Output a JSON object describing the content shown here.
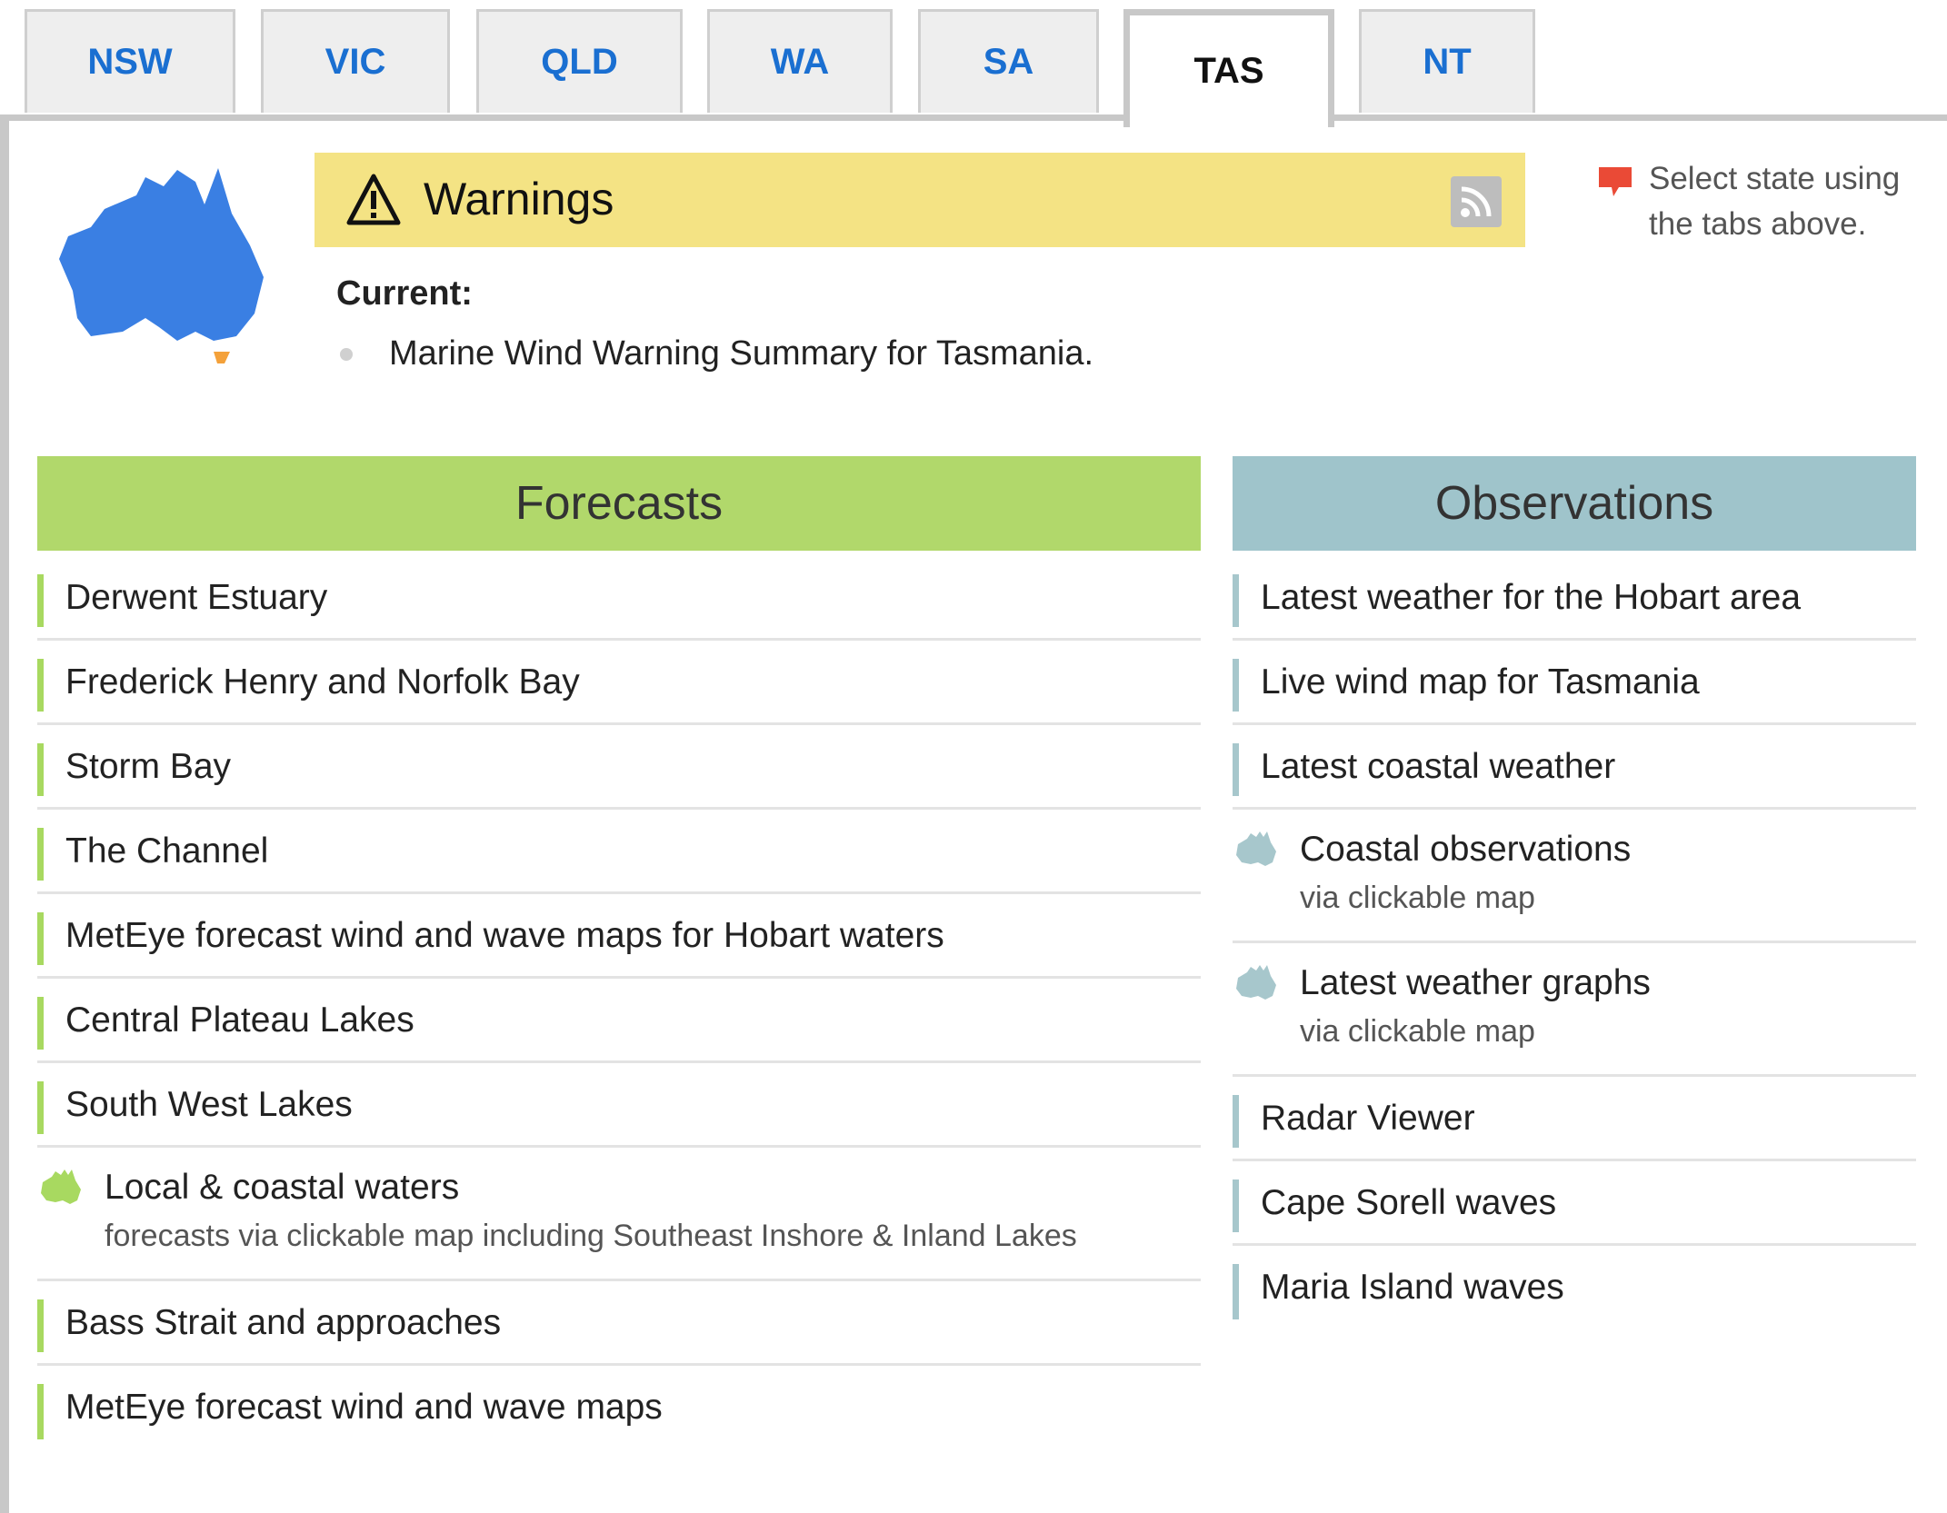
{
  "tabs": [
    "NSW",
    "VIC",
    "QLD",
    "WA",
    "SA",
    "TAS",
    "NT"
  ],
  "active_tab": "TAS",
  "colors": {
    "tab_text": "#1a6fd1",
    "warning_bg": "#f4e384",
    "forecast_accent": "#a8d960",
    "observation_accent": "#a7c7cc",
    "map_blue": "#3a7fe3",
    "tas_orange": "#f4a13a"
  },
  "warnings": {
    "title": "Warnings",
    "current_label": "Current:",
    "items": [
      "Marine Wind Warning Summary for Tasmania."
    ]
  },
  "hint": {
    "line1": "Select state using",
    "line2": "the tabs above."
  },
  "forecasts": {
    "title": "Forecasts",
    "items": [
      {
        "label": "Derwent Estuary"
      },
      {
        "label": "Frederick Henry and Norfolk Bay"
      },
      {
        "label": "Storm Bay"
      },
      {
        "label": "The Channel"
      },
      {
        "label": "MetEye forecast wind and wave maps for Hobart waters"
      },
      {
        "label": "Central Plateau Lakes"
      },
      {
        "label": "South West Lakes"
      },
      {
        "label": "Local & coastal waters",
        "sub": "forecasts via clickable map including Southeast Inshore & Inland Lakes"
      },
      {
        "label": "Bass Strait and approaches"
      },
      {
        "label": "MetEye forecast wind and wave maps"
      }
    ]
  },
  "observations": {
    "title": "Observations",
    "items": [
      {
        "label": "Latest weather for the Hobart area"
      },
      {
        "label": "Live wind map for Tasmania"
      },
      {
        "label": "Latest coastal weather"
      },
      {
        "label": "Coastal observations",
        "sub": "via clickable map"
      },
      {
        "label": "Latest weather graphs",
        "sub": "via clickable map"
      },
      {
        "label": "Radar Viewer"
      },
      {
        "label": "Cape Sorell waves"
      },
      {
        "label": "Maria Island waves"
      }
    ]
  }
}
